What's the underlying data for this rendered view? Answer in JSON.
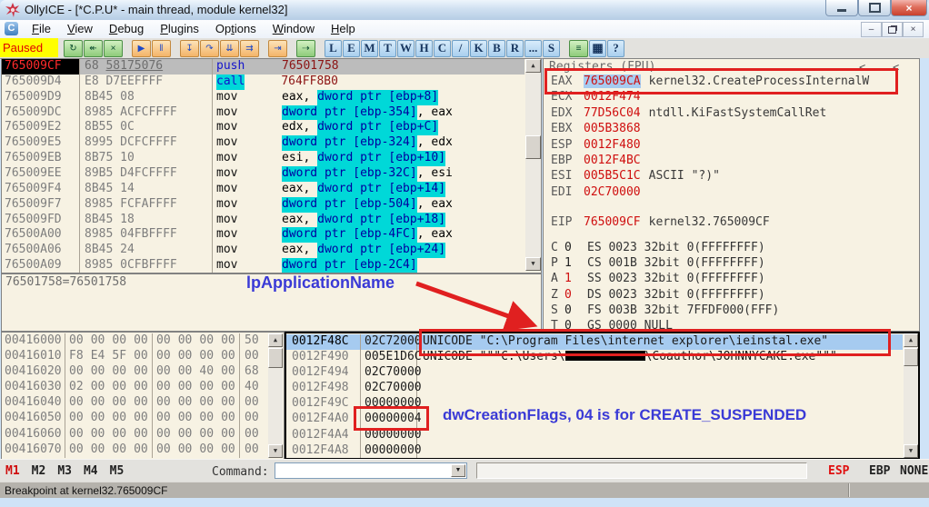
{
  "window": {
    "title": "OllyICE - [*C.P.U* - main thread, module kernel32]",
    "controls": {
      "minimize": "—",
      "maximize": "",
      "close": "×"
    },
    "mdi_controls": {
      "minimize": "–",
      "restore": "❏",
      "close": "×"
    }
  },
  "menu": {
    "icon": "C",
    "items": [
      {
        "label": "File",
        "accel": "F"
      },
      {
        "label": "View",
        "accel": "V"
      },
      {
        "label": "Debug",
        "accel": "D"
      },
      {
        "label": "Plugins",
        "accel": "P"
      },
      {
        "label": "Options",
        "accel": "t"
      },
      {
        "label": "Window",
        "accel": "W"
      },
      {
        "label": "Help",
        "accel": "H"
      }
    ]
  },
  "toolbar": {
    "status": "Paused",
    "buttons": [
      {
        "name": "restart-button",
        "glyph": "↻",
        "kind": "green",
        "gap": false
      },
      {
        "name": "rewind-button",
        "glyph": "↞",
        "kind": "green",
        "gap": false
      },
      {
        "name": "close-program-button",
        "glyph": "×",
        "kind": "green",
        "gap": false
      },
      {
        "name": "run-button",
        "glyph": "▶",
        "kind": "orange",
        "gap": true
      },
      {
        "name": "pause-button",
        "glyph": "‖",
        "kind": "orange",
        "gap": false
      },
      {
        "name": "step-into-button",
        "glyph": "↧",
        "kind": "orange",
        "gap": true
      },
      {
        "name": "step-over-button",
        "glyph": "↷",
        "kind": "orange",
        "gap": false
      },
      {
        "name": "animate-into-button",
        "glyph": "⇊",
        "kind": "orange",
        "gap": false
      },
      {
        "name": "animate-over-button",
        "glyph": "⇉",
        "kind": "orange",
        "gap": false
      },
      {
        "name": "execute-till-return-button",
        "glyph": "⇥",
        "kind": "orange",
        "gap": true
      },
      {
        "name": "goto-button",
        "glyph": "⇢",
        "kind": "green",
        "gap": true
      }
    ],
    "letters": [
      "L",
      "E",
      "M",
      "T",
      "W",
      "H",
      "C",
      "/",
      "K",
      "B",
      "R",
      "...",
      "S"
    ],
    "right_buttons": [
      {
        "name": "log-options-button",
        "glyph": "≡",
        "kind": "green"
      },
      {
        "name": "appearance-button",
        "glyph": "▦",
        "kind": "letter"
      },
      {
        "name": "help-button",
        "glyph": "?",
        "kind": "letter"
      }
    ]
  },
  "disasm": {
    "rows": [
      {
        "addr": "765009CF",
        "bytes": "68 ",
        "bytes_u": "58175076",
        "mn": "push",
        "mncls": "b",
        "sel": true,
        "ops": [
          {
            "t": "76501758",
            "c": "i"
          }
        ]
      },
      {
        "addr": "765009D4",
        "bytes": "E8 D7EEFFFF",
        "mn": "call",
        "mncls": "bh",
        "ops": [
          {
            "t": "764FF8B0",
            "c": "i"
          }
        ]
      },
      {
        "addr": "765009D9",
        "bytes": "8B45 08",
        "mn": "mov",
        "mncls": "",
        "ops": [
          {
            "t": "eax, ",
            "c": "p"
          },
          {
            "t": "dword ptr [ebp+8]",
            "c": "m"
          }
        ]
      },
      {
        "addr": "765009DC",
        "bytes": "8985 ACFCFFFF",
        "mn": "mov",
        "mncls": "",
        "ops": [
          {
            "t": "dword ptr [ebp-354]",
            "c": "m"
          },
          {
            "t": ", eax",
            "c": "p"
          }
        ]
      },
      {
        "addr": "765009E2",
        "bytes": "8B55 0C",
        "mn": "mov",
        "mncls": "",
        "ops": [
          {
            "t": "edx, ",
            "c": "p"
          },
          {
            "t": "dword ptr [ebp+C]",
            "c": "m"
          }
        ]
      },
      {
        "addr": "765009E5",
        "bytes": "8995 DCFCFFFF",
        "mn": "mov",
        "mncls": "",
        "ops": [
          {
            "t": "dword ptr [ebp-324]",
            "c": "m"
          },
          {
            "t": ", edx",
            "c": "p"
          }
        ]
      },
      {
        "addr": "765009EB",
        "bytes": "8B75 10",
        "mn": "mov",
        "mncls": "",
        "ops": [
          {
            "t": "esi, ",
            "c": "p"
          },
          {
            "t": "dword ptr [ebp+10]",
            "c": "m"
          }
        ]
      },
      {
        "addr": "765009EE",
        "bytes": "89B5 D4FCFFFF",
        "mn": "mov",
        "mncls": "",
        "ops": [
          {
            "t": "dword ptr [ebp-32C]",
            "c": "m"
          },
          {
            "t": ", esi",
            "c": "p"
          }
        ]
      },
      {
        "addr": "765009F4",
        "bytes": "8B45 14",
        "mn": "mov",
        "mncls": "",
        "ops": [
          {
            "t": "eax, ",
            "c": "p"
          },
          {
            "t": "dword ptr [ebp+14]",
            "c": "m"
          }
        ]
      },
      {
        "addr": "765009F7",
        "bytes": "8985 FCFAFFFF",
        "mn": "mov",
        "mncls": "",
        "ops": [
          {
            "t": "dword ptr [ebp-504]",
            "c": "m"
          },
          {
            "t": ", eax",
            "c": "p"
          }
        ]
      },
      {
        "addr": "765009FD",
        "bytes": "8B45 18",
        "mn": "mov",
        "mncls": "",
        "ops": [
          {
            "t": "eax, ",
            "c": "p"
          },
          {
            "t": "dword ptr [ebp+18]",
            "c": "m"
          }
        ]
      },
      {
        "addr": "76500A00",
        "bytes": "8985 04FBFFFF",
        "mn": "mov",
        "mncls": "",
        "ops": [
          {
            "t": "dword ptr [ebp-4FC]",
            "c": "m"
          },
          {
            "t": ", eax",
            "c": "p"
          }
        ]
      },
      {
        "addr": "76500A06",
        "bytes": "8B45 24",
        "mn": "mov",
        "mncls": "",
        "ops": [
          {
            "t": "eax, ",
            "c": "p"
          },
          {
            "t": "dword ptr [ebp+24]",
            "c": "m"
          }
        ]
      },
      {
        "addr": "76500A09",
        "bytes": "8985 0CFBFFFF",
        "mn": "mov",
        "mncls": "",
        "ops": [
          {
            "t": "dword ptr [ebp-2C4]",
            "c": "m"
          }
        ]
      }
    ],
    "info_line": "76501758=76501758"
  },
  "registers": {
    "header": "Registers (FPU)",
    "gpr": [
      {
        "name": "EAX",
        "val": "765009CA",
        "valSel": true,
        "comment": "kernel32.CreateProcessInternalW"
      },
      {
        "name": "ECX",
        "val": "0012F474",
        "comment": ""
      },
      {
        "name": "EDX",
        "val": "77D56C04",
        "comment": "ntdll.KiFastSystemCallRet"
      },
      {
        "name": "EBX",
        "val": "005B3868",
        "comment": ""
      },
      {
        "name": "ESP",
        "val": "0012F480",
        "comment": ""
      },
      {
        "name": "EBP",
        "val": "0012F4BC",
        "comment": ""
      },
      {
        "name": "ESI",
        "val": "005B5C1C",
        "comment": "ASCII \"?)\""
      },
      {
        "name": "EDI",
        "val": "02C70000",
        "comment": ""
      }
    ],
    "eip": {
      "name": "EIP",
      "val": "765009CF",
      "comment": "kernel32.765009CF"
    },
    "flags": [
      {
        "f": "C",
        "v": "0",
        "red": false,
        "seg": "ES 0023 32bit 0(FFFFFFFF)"
      },
      {
        "f": "P",
        "v": "1",
        "red": false,
        "seg": "CS 001B 32bit 0(FFFFFFFF)"
      },
      {
        "f": "A",
        "v": "1",
        "red": true,
        "seg": "SS 0023 32bit 0(FFFFFFFF)"
      },
      {
        "f": "Z",
        "v": "0",
        "red": true,
        "seg": "DS 0023 32bit 0(FFFFFFFF)"
      },
      {
        "f": "S",
        "v": "0",
        "red": false,
        "seg": "FS 003B 32bit 7FFDF000(FFF)"
      },
      {
        "f": "T",
        "v": "0",
        "red": false,
        "seg": "GS 0000 NULL"
      }
    ]
  },
  "dump": {
    "rows": [
      {
        "addr": "00416000",
        "g1": [
          "00",
          "00",
          "00",
          "00"
        ],
        "g2": [
          "00",
          "00",
          "00",
          "00"
        ],
        "extra": "50"
      },
      {
        "addr": "00416010",
        "g1": [
          "F8",
          "E4",
          "5F",
          "00"
        ],
        "g2": [
          "00",
          "00",
          "00",
          "00"
        ],
        "extra": "00"
      },
      {
        "addr": "00416020",
        "g1": [
          "00",
          "00",
          "00",
          "00"
        ],
        "g2": [
          "00",
          "00",
          "40",
          "00"
        ],
        "extra": "68"
      },
      {
        "addr": "00416030",
        "g1": [
          "02",
          "00",
          "00",
          "00"
        ],
        "g2": [
          "00",
          "00",
          "00",
          "00"
        ],
        "extra": "40"
      },
      {
        "addr": "00416040",
        "g1": [
          "00",
          "00",
          "00",
          "00"
        ],
        "g2": [
          "00",
          "00",
          "00",
          "00"
        ],
        "extra": "00"
      },
      {
        "addr": "00416050",
        "g1": [
          "00",
          "00",
          "00",
          "00"
        ],
        "g2": [
          "00",
          "00",
          "00",
          "00"
        ],
        "extra": "00"
      },
      {
        "addr": "00416060",
        "g1": [
          "00",
          "00",
          "00",
          "00"
        ],
        "g2": [
          "00",
          "00",
          "00",
          "00"
        ],
        "extra": "00"
      },
      {
        "addr": "00416070",
        "g1": [
          "00",
          "00",
          "00",
          "00"
        ],
        "g2": [
          "00",
          "00",
          "00",
          "00"
        ],
        "extra": "00"
      }
    ]
  },
  "stack": {
    "rows": [
      {
        "addr": "0012F48C",
        "val": "02C72000",
        "sel": true,
        "comment": "UNICODE \"C:\\Program Files\\internet explorer\\ieinstal.exe\""
      },
      {
        "addr": "0012F490",
        "val": "005E1D6C",
        "redacted": true,
        "commentPrefix": "UNICODE \"\"\"C:\\Users\\",
        "commentSuffix": "\\Coauthor\\JOHNNYCAKE.exe\"\"\""
      },
      {
        "addr": "0012F494",
        "val": "02C70000",
        "comment": ""
      },
      {
        "addr": "0012F498",
        "val": "02C70000",
        "comment": ""
      },
      {
        "addr": "0012F49C",
        "val": "00000000",
        "comment": ""
      },
      {
        "addr": "0012F4A0",
        "val": "00000004",
        "comment": ""
      },
      {
        "addr": "0012F4A4",
        "val": "00000000",
        "comment": ""
      },
      {
        "addr": "0012F4A8",
        "val": "00000000",
        "comment": ""
      }
    ]
  },
  "annotations": {
    "lp_application_name": "lpApplicationName",
    "dw_creation_flags": "dwCreationFlags, 04 is for CREATE_SUSPENDED",
    "highlight_color": "#e02020",
    "text_color": "#3a3ad6"
  },
  "command_bar": {
    "tabs": [
      {
        "label": "M1",
        "active": true
      },
      {
        "label": "M2",
        "active": false
      },
      {
        "label": "M3",
        "active": false
      },
      {
        "label": "M4",
        "active": false
      },
      {
        "label": "M5",
        "active": false
      }
    ],
    "command_label": "Command:",
    "command_value": "",
    "reg_buttons": [
      {
        "label": "ESP",
        "active": true
      },
      {
        "label": "EBP",
        "active": false
      },
      {
        "label": "NONE",
        "active": false
      }
    ]
  },
  "statusbar": {
    "message": "Breakpoint at kernel32.765009CF"
  }
}
